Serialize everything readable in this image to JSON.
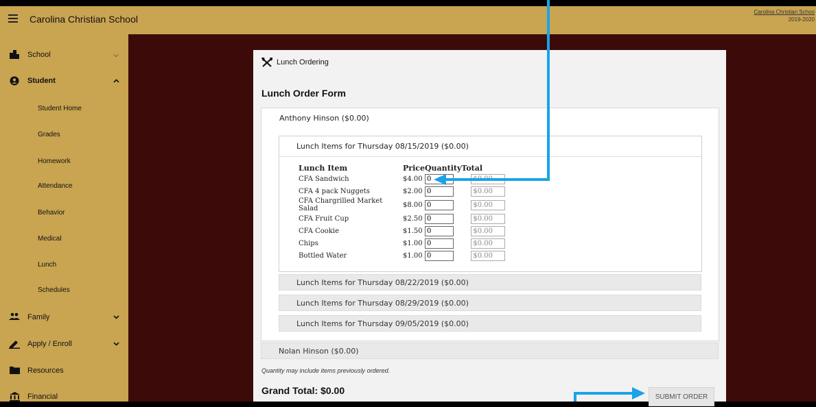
{
  "header": {
    "app_title": "Carolina Christian School",
    "school_link": "Carolina Christian Schoo",
    "school_year": "2019-2020"
  },
  "sidebar": {
    "items": [
      {
        "label": "School",
        "icon": "building-icon"
      },
      {
        "label": "Student",
        "icon": "person-circle-icon"
      },
      {
        "label": "Family",
        "icon": "people-icon"
      },
      {
        "label": "Apply / Enroll",
        "icon": "pencil-icon"
      },
      {
        "label": "Resources",
        "icon": "folder-icon"
      },
      {
        "label": "Financial",
        "icon": "bank-icon"
      }
    ],
    "student_subitems": [
      "Student Home",
      "Grades",
      "Homework",
      "Attendance",
      "Behavior",
      "Medical",
      "Lunch",
      "Schedules"
    ]
  },
  "panel": {
    "section_title": "Lunch Ordering",
    "form_title": "Lunch Order Form",
    "student1": "Anthony Hinson ($0.00)",
    "day_open": "Lunch Items for Thursday 08/15/2019 ($0.00)",
    "table_headers": {
      "item": "Lunch Item",
      "price": "Price",
      "quantity": "Quantity",
      "total": "Total"
    },
    "items": [
      {
        "name": "CFA Sandwich",
        "price": "$4.00",
        "qty": "0",
        "total": "$0.00"
      },
      {
        "name": "CFA 4 pack Nuggets",
        "price": "$2.00",
        "qty": "0",
        "total": "$0.00"
      },
      {
        "name": "CFA Chargrilled Market Salad",
        "price": "$8.00",
        "qty": "0",
        "total": "$0.00"
      },
      {
        "name": "CFA Fruit Cup",
        "price": "$2.50",
        "qty": "0",
        "total": "$0.00"
      },
      {
        "name": "CFA Cookie",
        "price": "$1.50",
        "qty": "0",
        "total": "$0.00"
      },
      {
        "name": "Chips",
        "price": "$1.00",
        "qty": "0",
        "total": "$0.00"
      },
      {
        "name": "Bottled Water",
        "price": "$1.00",
        "qty": "0",
        "total": "$0.00"
      }
    ],
    "days_closed": [
      "Lunch Items for Thursday 08/22/2019 ($0.00)",
      "Lunch Items for Thursday 08/29/2019 ($0.00)",
      "Lunch Items for Thursday 09/05/2019 ($0.00)"
    ],
    "student2": "Nolan Hinson ($0.00)",
    "note": "Quantity may include items previously ordered.",
    "grand_total": "Grand Total: $0.00",
    "submit_label": "SUBMIT ORDER"
  },
  "colors": {
    "sidebar": "#c9a451",
    "content": "#3d0a0a",
    "annotation": "#1aa3e8"
  }
}
